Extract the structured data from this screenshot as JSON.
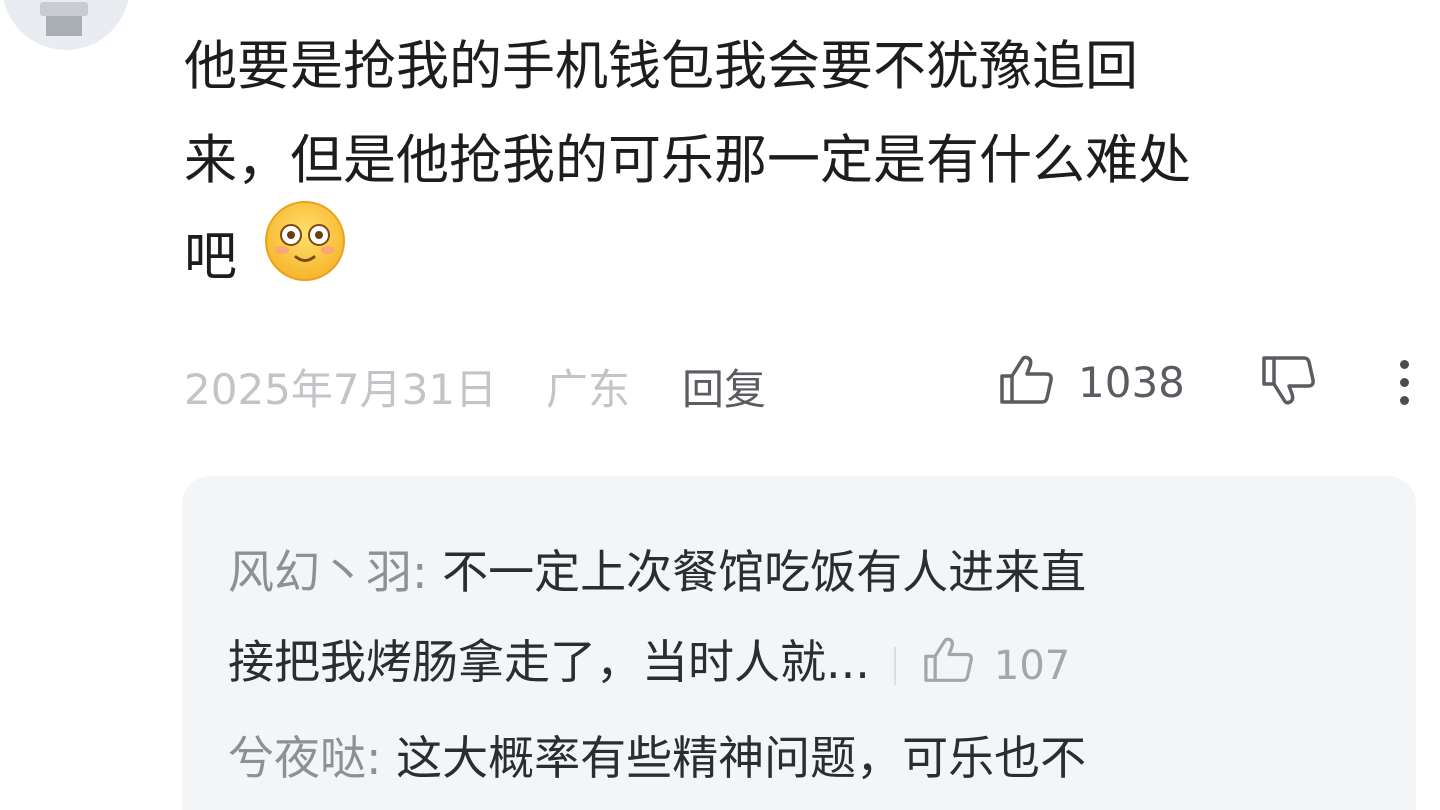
{
  "comment": {
    "lines": [
      "他要是抢我的手机钱包我会要不犹豫追回",
      "来，但是他抢我的可乐那一定是有什么难处",
      "吧"
    ],
    "emoji": "flushed-face-emoji"
  },
  "meta": {
    "date": "2025年7月31日",
    "location": "广东",
    "reply_label": "回复",
    "like_count": "1038"
  },
  "icons": {
    "like": "thumbs-up-outline-icon",
    "dislike": "thumbs-down-outline-icon",
    "more": "more-vertical-icon"
  },
  "replies": [
    {
      "author": "风幻丶羽:",
      "text_line1": "不一定上次餐馆吃饭有人进来直",
      "text_line2": "接把我烤肠拿走了，当时人就...",
      "like_count": "107"
    },
    {
      "author": "兮夜哒:",
      "text_line1": "这大概率有些精神问题，可乐也不"
    }
  ]
}
